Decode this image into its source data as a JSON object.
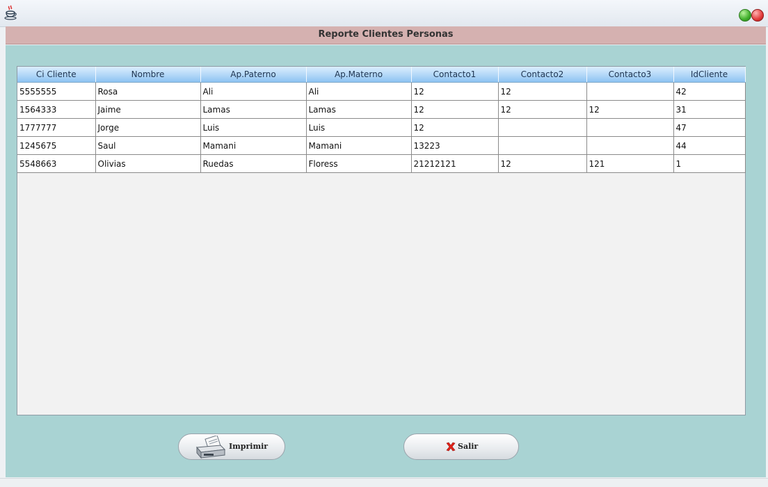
{
  "report": {
    "title": "Reporte Clientes Personas"
  },
  "table": {
    "columns": [
      "Ci Cliente",
      "Nombre",
      "Ap.Paterno",
      "Ap.Materno",
      "Contacto1",
      "Contacto2",
      "Contacto3",
      "IdCliente"
    ],
    "rows": [
      [
        "5555555",
        "Rosa",
        "Ali",
        "Ali",
        "12",
        "12",
        "",
        "42"
      ],
      [
        "1564333",
        "Jaime",
        "Lamas",
        "Lamas",
        "12",
        "12",
        "12",
        "31"
      ],
      [
        "1777777",
        "Jorge",
        "Luis",
        "Luis",
        "12",
        "",
        "",
        "47"
      ],
      [
        "1245675",
        "Saul",
        "Mamani",
        "Mamani",
        "13223",
        "",
        "",
        "44"
      ],
      [
        "5548663",
        "Olivias",
        "Ruedas",
        "Floress",
        "21212121",
        "12",
        "121",
        "1"
      ]
    ]
  },
  "buttons": {
    "print_label": "Imprimir",
    "exit_label": "Salir"
  },
  "icons": {
    "app": "java-cup-icon",
    "print": "printer-icon",
    "exit": "x-icon"
  }
}
